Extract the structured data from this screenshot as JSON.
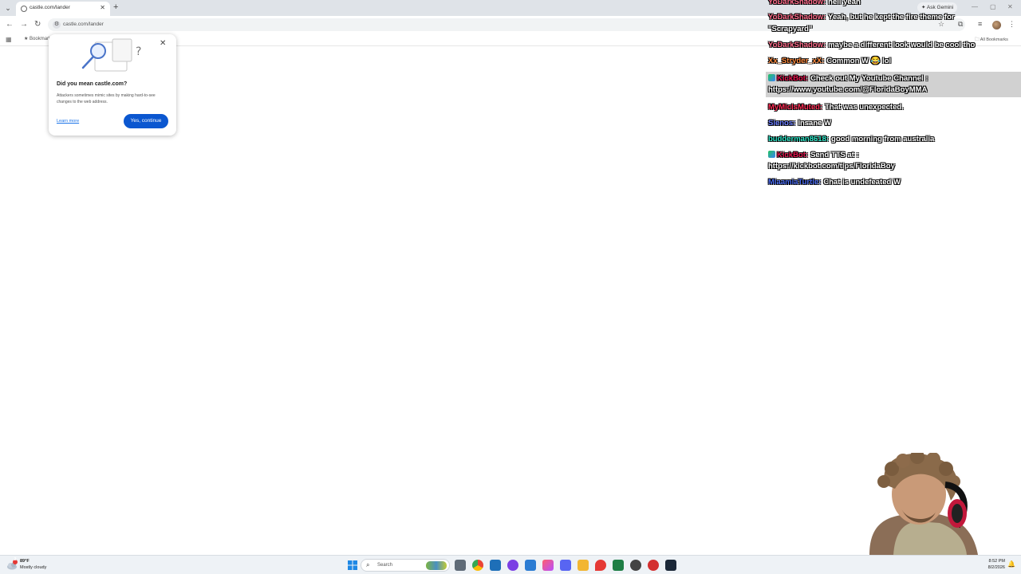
{
  "browser": {
    "tab_title": "castle.com/lander",
    "url": "castle.com/lander",
    "ask_gemini": "Ask Gemini",
    "bookmarks_bar_item": "Bookmarks",
    "all_bookmarks": "All Bookmarks"
  },
  "lookalike_bubble": {
    "title": "Did you mean castle.com?",
    "description": "Attackers sometimes mimic sites by making hard-to-see changes to the web address.",
    "learn_more": "Learn more",
    "confirm_button": "Yes, continue"
  },
  "chat": {
    "colors": {
      "highlight_user": "#ff3b6b",
      "kickbot": "#e8124e",
      "link_user": "#4c6ef5",
      "cyan_user": "#2ee6c8",
      "orange_user": "#ff8a3d"
    },
    "messages": [
      {
        "user": "YoDarkShadow:",
        "text": "hell yeah",
        "user_color": "#ff6b8a"
      },
      {
        "user": "YoDarkShadow:",
        "text": "Yeah, but he kept the fire theme for",
        "user_color": "#ff6b8a"
      },
      {
        "user": "",
        "text": "\"Scrapyard\"",
        "user_color": "#ffffff"
      },
      {
        "user": "YoDarkShadow:",
        "text": "maybe a different look would be cool tho",
        "user_color": "#ff6b8a"
      },
      {
        "user": "Xx_Stryder_xX:",
        "text": "Common W 😂 lol",
        "user_color": "#ff8a3d"
      },
      {
        "user": "KickBot:",
        "text": "Check out My Youtube Channel :",
        "user_color": "#e8124e"
      },
      {
        "user": "",
        "text": "https://www.youtube.com/@FloridaBoyMMA",
        "user_color": "#ffffff"
      },
      {
        "user": "MyMicIsMuted:",
        "text": "That was unexpected.",
        "user_color": "#ff2d55"
      },
      {
        "user": "Sienos:",
        "text": "Insane W",
        "user_color": "#6a7cff"
      },
      {
        "user": "budderman8618:",
        "text": "good morning from australia",
        "user_color": "#2ee6c8"
      },
      {
        "user": "KickBot:",
        "text": "Send TTS at :",
        "user_color": "#e8124e"
      },
      {
        "user": "",
        "text": "https://kickbot.com/tips/FloridaBoy",
        "user_color": "#ffffff"
      },
      {
        "user": "MiaamiaTurtle:",
        "text": "Chat is undefeated W",
        "user_color": "#4c6ef5"
      }
    ]
  },
  "taskbar": {
    "weather_temp": "89°F",
    "weather_desc": "Mostly cloudy",
    "weather_alert": "2",
    "search_label": "Search",
    "time": "8:52 PM",
    "date": "8/2/2026"
  }
}
